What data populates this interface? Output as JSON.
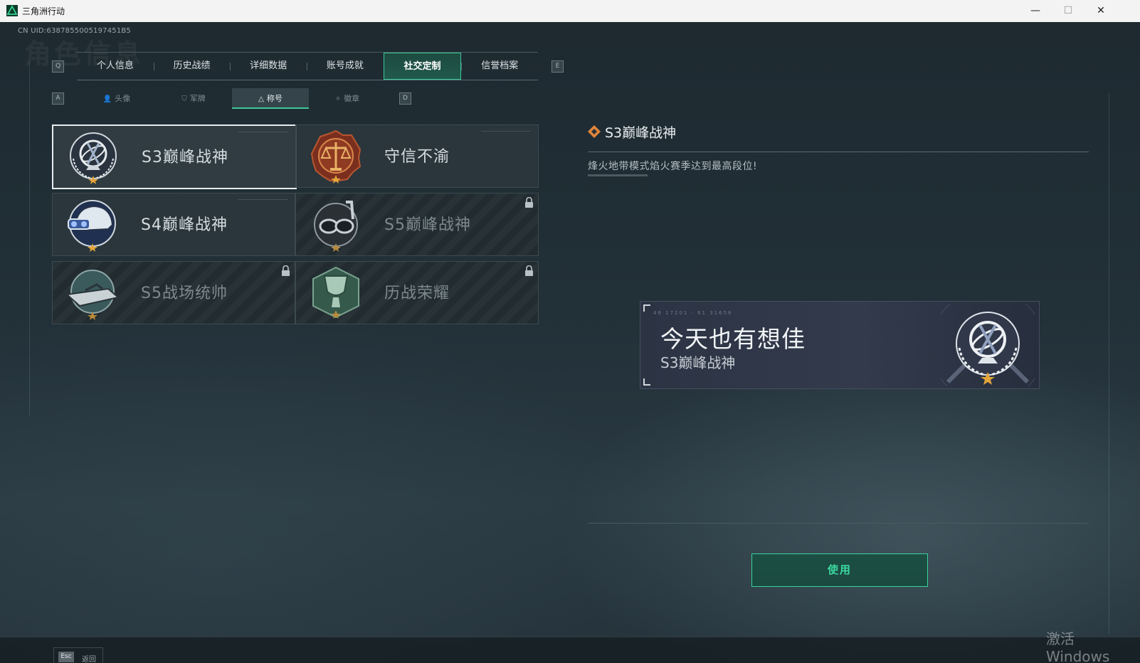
{
  "window": {
    "title": "三角洲行动",
    "minimize": "—",
    "maximize": "☐",
    "close": "✕"
  },
  "uid": "CN UID:6387855005197451B5",
  "bg_title": "角色信息",
  "keys": {
    "prev_tab": "Q",
    "next_tab": "E",
    "prev_sub": "A",
    "next_sub": "D"
  },
  "tabs": [
    {
      "label": "个人信息"
    },
    {
      "label": "历史战绩"
    },
    {
      "label": "详细数据"
    },
    {
      "label": "账号成就"
    },
    {
      "label": "社交定制",
      "active": true
    },
    {
      "label": "信誉档案"
    }
  ],
  "subtabs": [
    {
      "label": "头像",
      "icon": "person-icon"
    },
    {
      "label": "军牌",
      "icon": "dogtag-icon"
    },
    {
      "label": "称号",
      "icon": "triangle-icon",
      "active": true
    },
    {
      "label": "徽章",
      "icon": "emblem-icon"
    }
  ],
  "titles": [
    {
      "label": "S3巅峰战神",
      "badge": "armillary-badge-icon",
      "locked": false,
      "selected": true
    },
    {
      "label": "守信不渝",
      "badge": "scales-badge-icon",
      "locked": false,
      "selected": false
    },
    {
      "label": "S4巅峰战神",
      "badge": "helmet-badge-icon",
      "locked": false,
      "selected": false
    },
    {
      "label": "S5巅峰战神",
      "badge": "diving-mask-badge-icon",
      "locked": true,
      "selected": false
    },
    {
      "label": "S5战场统帅",
      "badge": "boat-badge-icon",
      "locked": true,
      "selected": false
    },
    {
      "label": "历战荣耀",
      "badge": "trophy-badge-icon",
      "locked": true,
      "selected": false
    }
  ],
  "detail": {
    "title": "S3巅峰战神",
    "description": "烽火地带模式焰火赛季达到最高段位!"
  },
  "namecard": {
    "code": "46 17201 · 61 31656",
    "player_name": "今天也有想佳",
    "title": "S3巅峰战神"
  },
  "use_button": "使用",
  "footer": {
    "esc_key": "Esc",
    "esc_label": "返回"
  },
  "watermark": "激活 Windows",
  "colors": {
    "accent": "#3bd39c",
    "active_tab_bg": "#21594c",
    "badge_gold": "#e3a43a"
  }
}
